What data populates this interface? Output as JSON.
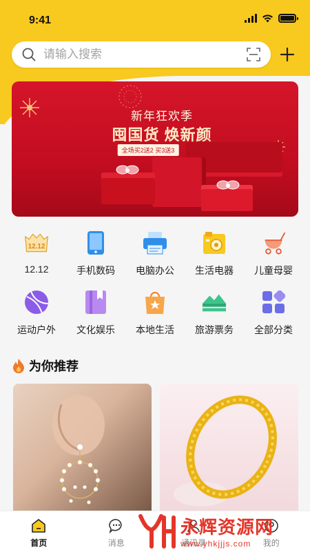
{
  "status_bar": {
    "time": "9:41",
    "battery_level": 1.0
  },
  "search": {
    "placeholder": "请输入搜索"
  },
  "banner": {
    "title": "新年狂欢季",
    "headline": "囤国货 焕新颜",
    "promo": "全场买2送2 买3送3"
  },
  "categories": [
    {
      "label": "12.12",
      "icon": "calendar-1212-icon"
    },
    {
      "label": "手机数码",
      "icon": "phone-icon"
    },
    {
      "label": "电脑办公",
      "icon": "printer-icon"
    },
    {
      "label": "生活电器",
      "icon": "appliance-icon"
    },
    {
      "label": "儿童母婴",
      "icon": "stroller-icon"
    },
    {
      "label": "运动户外",
      "icon": "ball-icon"
    },
    {
      "label": "文化娱乐",
      "icon": "book-icon"
    },
    {
      "label": "本地生活",
      "icon": "shopping-bag-icon"
    },
    {
      "label": "旅游票务",
      "icon": "ticket-icon"
    },
    {
      "label": "全部分类",
      "icon": "grid-icon"
    }
  ],
  "recommend": {
    "title": "为你推荐"
  },
  "tabbar": {
    "items": [
      {
        "label": "首页",
        "active": true
      },
      {
        "label": "消息",
        "active": false
      },
      {
        "label": "通讯录",
        "active": false
      },
      {
        "label": "我的",
        "active": false
      }
    ]
  },
  "watermark": {
    "name": "永辉资源网",
    "url": "www.yhkjjjs.com"
  },
  "colors": {
    "accent": "#f8c91f",
    "banner": "#d5152a",
    "watermark": "#e4352a"
  }
}
